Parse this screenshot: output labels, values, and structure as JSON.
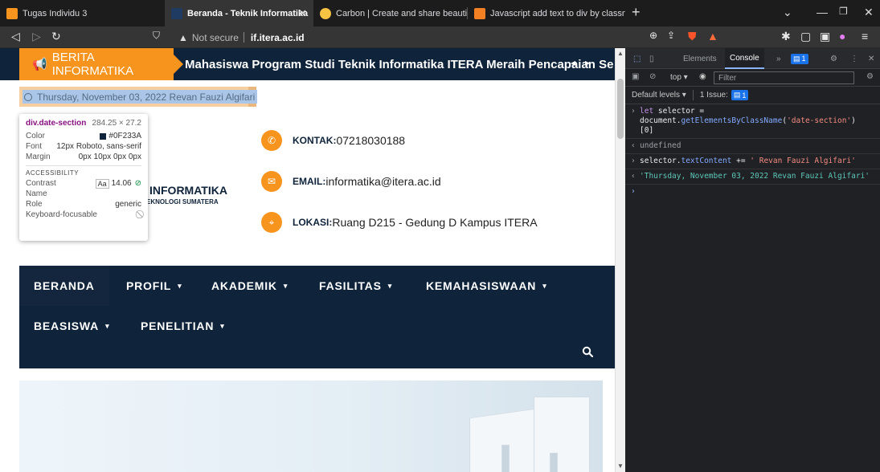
{
  "tabs": [
    {
      "title": "Tugas Individu 3",
      "favicon_color": "#f7941d"
    },
    {
      "title": "Beranda - Teknik Informatika",
      "favicon_color": "#0f233a",
      "active": true
    },
    {
      "title": "Carbon | Create and share beautiful im",
      "favicon_color": "#f6c343"
    },
    {
      "title": "Javascript add text to div by classnam",
      "favicon_color": "#f48024"
    }
  ],
  "toolbar": {
    "security_label": "Not secure",
    "host": "if.itera.ac.id"
  },
  "page": {
    "news_label": "BERITA INFORMATIKA",
    "news_headline": "Mahasiswa Program Studi Teknik Informatika ITERA Meraih Pencapaian Se",
    "date_text": "Thursday, November 03, 2022 Revan Fauzi Algifari",
    "tooltip": {
      "selector": "div.date-section",
      "dimensions": "284.25 × 27.2",
      "color_label": "Color",
      "color_value": "#0F233A",
      "font_label": "Font",
      "font_value": "12px Roboto, sans-serif",
      "margin_label": "Margin",
      "margin_value": "0px 10px 0px 0px",
      "accessibility_label": "ACCESSIBILITY",
      "contrast_label": "Contrast",
      "contrast_aa": "Aa",
      "contrast_value": "14.06",
      "name_label": "Name",
      "role_label": "Role",
      "role_value": "generic",
      "focus_label": "Keyboard-focusable"
    },
    "logo_title": "INFORMATIKA",
    "logo_subtitle": "EKNOLOGI SUMATERA",
    "contacts": [
      {
        "label": "KONTAK:",
        "value": "07218030188",
        "icon": "phone-icon"
      },
      {
        "label": "EMAIL:",
        "value": "informatika@itera.ac.id",
        "icon": "mail-icon"
      },
      {
        "label": "LOKASI:",
        "value": "Ruang D215 - Gedung D Kampus ITERA",
        "icon": "location-icon"
      }
    ],
    "nav": [
      {
        "label": "BERANDA"
      },
      {
        "label": "PROFIL"
      },
      {
        "label": "AKADEMIK"
      },
      {
        "label": "FASILITAS"
      },
      {
        "label": "KEMAHASISWAAN"
      },
      {
        "label": "BEASISWA"
      },
      {
        "label": "PENELITIAN"
      }
    ]
  },
  "devtools": {
    "tabs": [
      "Elements",
      "Console"
    ],
    "issues_badge": "1",
    "context": "top",
    "filter_placeholder": "Filter",
    "levels_label": "Default levels",
    "issues_label": "1 Issue:",
    "issues_count": "1",
    "console": [
      {
        "kw": "let",
        "plain1": " selector =",
        "plain2": "document.",
        "fn": "getElementsByClassName",
        "open": "(",
        "str": "'date-section'",
        "close": ")",
        "idx": "[0]"
      },
      {
        "out": "undefined"
      },
      {
        "prop": "selector.",
        "fn": "textContent",
        "op": " += ",
        "str": "' Revan Fauzi Algifari'"
      },
      {
        "out_str": "'Thursday, November 03, 2022 Revan Fauzi Algifari'"
      }
    ]
  },
  "colors": {
    "navy": "#0f233a",
    "orange": "#f7941d"
  }
}
